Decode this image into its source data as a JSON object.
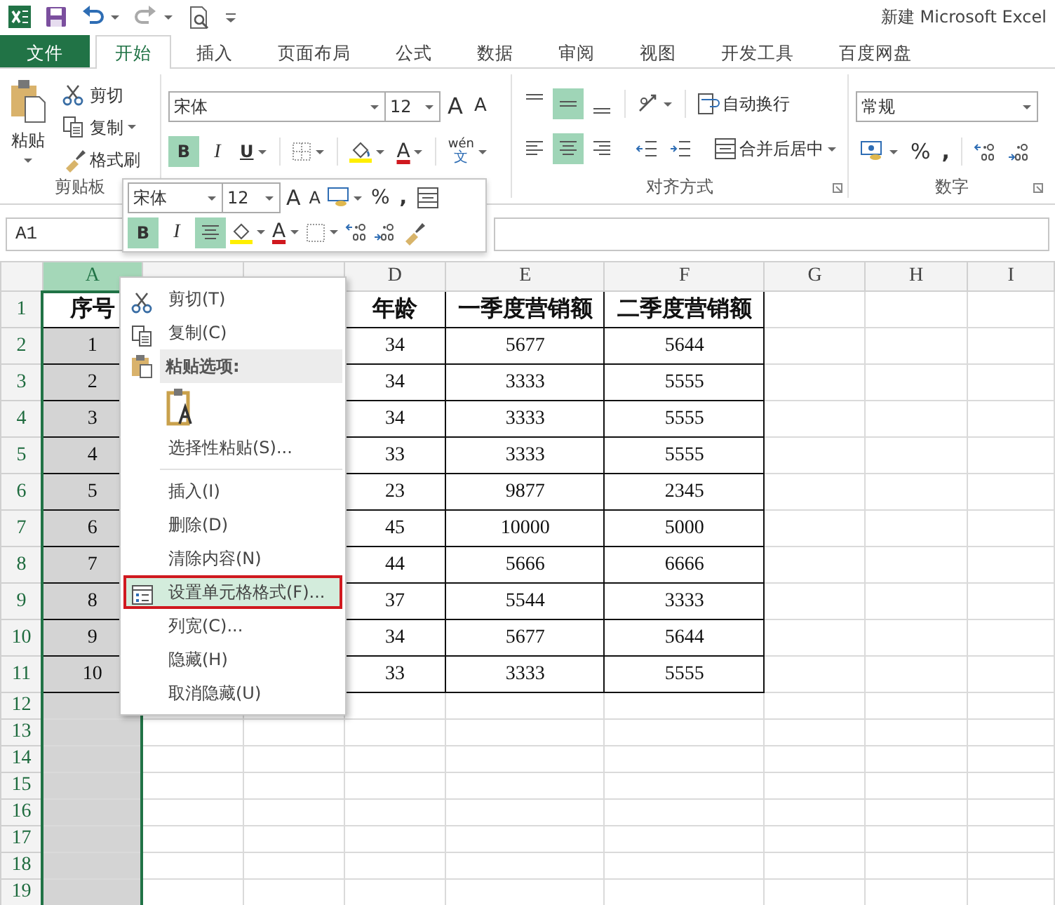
{
  "window": {
    "title": "新建 Microsoft Excel"
  },
  "tabs": [
    {
      "label": "文件",
      "kind": "file",
      "selected": false
    },
    {
      "label": "开始",
      "kind": "tab",
      "selected": true
    },
    {
      "label": "插入",
      "kind": "tab",
      "selected": false
    },
    {
      "label": "页面布局",
      "kind": "tab",
      "selected": false
    },
    {
      "label": "公式",
      "kind": "tab",
      "selected": false
    },
    {
      "label": "数据",
      "kind": "tab",
      "selected": false
    },
    {
      "label": "审阅",
      "kind": "tab",
      "selected": false
    },
    {
      "label": "视图",
      "kind": "tab",
      "selected": false
    },
    {
      "label": "开发工具",
      "kind": "tab",
      "selected": false
    },
    {
      "label": "百度网盘",
      "kind": "tab",
      "selected": false
    }
  ],
  "clipboard": {
    "label": "剪贴板",
    "paste": "粘贴",
    "cut": "剪切",
    "copy": "复制",
    "painter": "格式刷"
  },
  "font": {
    "font_name": "宋体",
    "font_size": "12",
    "grow": "A",
    "shrink": "A",
    "bold": {
      "label": "B",
      "on": true
    },
    "italic": {
      "label": "I",
      "on": false
    },
    "underline": {
      "label": "U",
      "on": false
    },
    "font_color": "A",
    "phonetic_top": "wén",
    "phonetic_bottom": "文"
  },
  "alignment": {
    "label": "对齐方式",
    "vertical": [
      {
        "selected": false
      },
      {
        "selected": true
      },
      {
        "selected": false
      }
    ],
    "horizontal": [
      {
        "selected": false
      },
      {
        "selected": true
      },
      {
        "selected": false
      }
    ],
    "wrap": "自动换行",
    "merge": "合并后居中"
  },
  "number": {
    "label": "数字",
    "format": "常规",
    "percent": "%",
    "comma": ","
  },
  "name_box": "A1",
  "mini_toolbar": {
    "font_name": "宋体",
    "font_size": "12",
    "grow": "A",
    "shrink": "A",
    "percent": "%",
    "comma": ",",
    "bold": {
      "label": "B",
      "on": true
    },
    "italic": {
      "label": "I",
      "on": false
    },
    "center": {
      "on": true
    },
    "font_color": "A"
  },
  "sheet": {
    "columns": [
      {
        "label": "A",
        "selected": true
      },
      {
        "selected": false
      },
      {
        "selected": false
      },
      {
        "label": "D",
        "selected": false
      },
      {
        "label": "E",
        "selected": false
      },
      {
        "label": "F",
        "selected": false
      },
      {
        "label": "G",
        "selected": false
      },
      {
        "label": "H",
        "selected": false
      },
      {
        "label": "I",
        "selected": false
      }
    ],
    "rows": [
      {
        "label": "1",
        "kind": "header",
        "a": "序号",
        "d": "年龄",
        "e": "一季度营销额",
        "f": "二季度营销额"
      },
      {
        "label": "2",
        "kind": "data",
        "a": "1",
        "d": "34",
        "e": "5677",
        "f": "5644"
      },
      {
        "label": "3",
        "kind": "data",
        "a": "2",
        "d": "34",
        "e": "3333",
        "f": "5555"
      },
      {
        "label": "4",
        "kind": "data",
        "a": "3",
        "d": "34",
        "e": "3333",
        "f": "5555"
      },
      {
        "label": "5",
        "kind": "data",
        "a": "4",
        "d": "33",
        "e": "3333",
        "f": "5555"
      },
      {
        "label": "6",
        "kind": "data",
        "a": "5",
        "d": "23",
        "e": "9877",
        "f": "2345"
      },
      {
        "label": "7",
        "kind": "data",
        "a": "6",
        "d": "45",
        "e": "10000",
        "f": "5000"
      },
      {
        "label": "8",
        "kind": "data",
        "a": "7",
        "d": "44",
        "e": "5666",
        "f": "6666"
      },
      {
        "label": "9",
        "kind": "data",
        "a": "8",
        "d": "37",
        "e": "5544",
        "f": "3333"
      },
      {
        "label": "10",
        "kind": "data",
        "a": "9",
        "d": "34",
        "e": "5677",
        "f": "5644"
      },
      {
        "label": "11",
        "kind": "data",
        "a": "10",
        "d": "33",
        "e": "3333",
        "f": "5555"
      },
      {
        "label": "12",
        "kind": "empty"
      },
      {
        "label": "13",
        "kind": "empty"
      },
      {
        "label": "14",
        "kind": "empty"
      },
      {
        "label": "15",
        "kind": "empty"
      },
      {
        "label": "16",
        "kind": "empty"
      },
      {
        "label": "17",
        "kind": "empty"
      },
      {
        "label": "18",
        "kind": "empty"
      },
      {
        "label": "19",
        "kind": "empty"
      }
    ]
  },
  "context_menu": [
    {
      "kind": "cut",
      "label": "剪切(T)",
      "selected": false,
      "outlined": false
    },
    {
      "kind": "copy",
      "label": "复制(C)",
      "selected": false,
      "outlined": false
    },
    {
      "kind": "section",
      "label": "粘贴选项:"
    },
    {
      "kind": "paste_option"
    },
    {
      "kind": "item",
      "label": "选择性粘贴(S)...",
      "selected": false,
      "outlined": false
    },
    {
      "kind": "separator"
    },
    {
      "kind": "item",
      "label": "插入(I)",
      "selected": false,
      "outlined": false
    },
    {
      "kind": "item",
      "label": "删除(D)",
      "selected": false,
      "outlined": false
    },
    {
      "kind": "item",
      "label": "清除内容(N)",
      "selected": false,
      "outlined": false
    },
    {
      "kind": "format",
      "label": "设置单元格格式(F)...",
      "selected": true,
      "outlined": true
    },
    {
      "kind": "item",
      "label": "列宽(C)...",
      "selected": false,
      "outlined": false
    },
    {
      "kind": "item",
      "label": "隐藏(H)",
      "selected": false,
      "outlined": false
    },
    {
      "kind": "item",
      "label": "取消隐藏(U)",
      "selected": false,
      "outlined": false
    }
  ]
}
